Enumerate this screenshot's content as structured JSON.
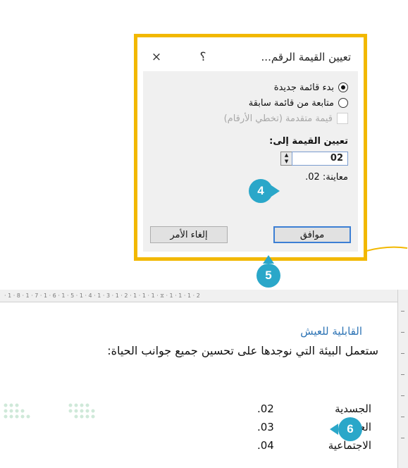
{
  "dialog": {
    "title": "تعيين القيمة الرقم...",
    "help_glyph": "؟",
    "close_glyph": "×",
    "options": {
      "new_list": "بدء قائمة جديدة",
      "continue_list": "متابعة من قائمة سابقة",
      "advance_value": "قيمة متقدمة (تخطي الأرقام)"
    },
    "set_value_label": "تعيين القيمة إلى:",
    "value": "02",
    "spin_up": "▲",
    "spin_down": "▼",
    "preview": "معاينة: 02.",
    "ok_label": "موافق",
    "cancel_label": "إلغاء الأمر"
  },
  "callouts": {
    "step4": "4",
    "step5": "5",
    "step6": "6"
  },
  "colors": {
    "frame": "#f2b800",
    "callout": "#2aa7c9",
    "heading": "#2e74b5"
  },
  "document": {
    "ruler": "· 1 · 8 · 1 · 7 · 1 · 6 · 1 · 5 · 1 · 4 · 1 · 3 · 1 · 2 · 1 · 1 · 1 · ⧖ · 1 · 1 · 1 · 2",
    "heading": "القابلية للعيش",
    "sentence": "ستعمل البيئة التي نوجدها على تحسين جميع جوانب الحياة:",
    "items": [
      {
        "num": ".02",
        "text": "الجسدية"
      },
      {
        "num": ".03",
        "text": "العقلية"
      },
      {
        "num": ".04",
        "text": "الاجتماعية"
      }
    ]
  }
}
